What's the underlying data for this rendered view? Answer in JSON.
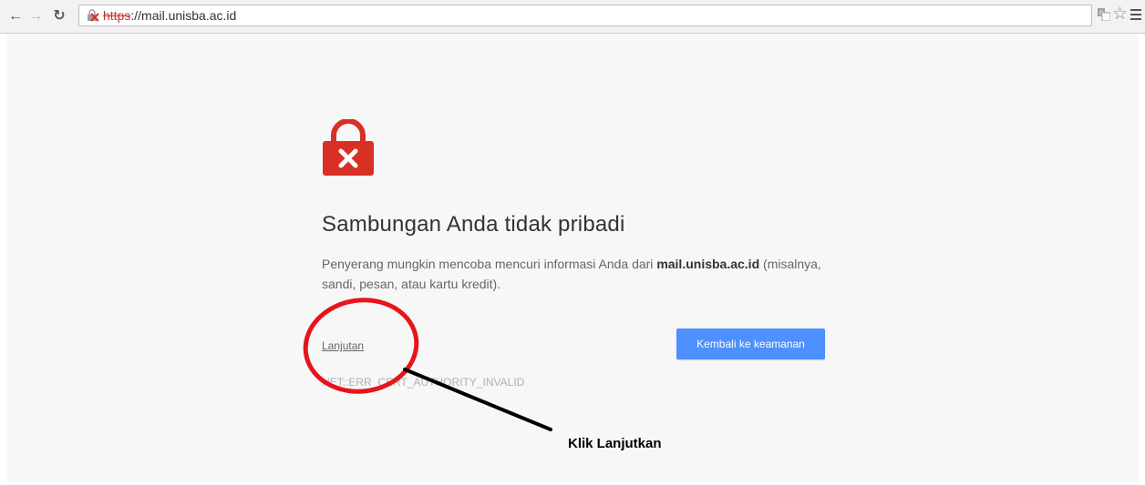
{
  "browser": {
    "url_scheme": "https",
    "url_rest": "://mail.unisba.ac.id"
  },
  "interstitial": {
    "heading": "Sambungan Anda tidak pribadi",
    "explanation_before": "Penyerang mungkin mencoba mencuri informasi Anda dari ",
    "explanation_domain": "mail.unisba.ac.id",
    "explanation_after": " (misalnya, sandi, pesan, atau kartu kredit).",
    "advanced_link": "Lanjutan",
    "back_button": "Kembali ke keamanan",
    "error_code": "NET::ERR_CERT_AUTHORITY_INVALID"
  },
  "annotation": {
    "label": "Klik Lanjutkan"
  },
  "icons": {
    "back": "back-arrow-icon",
    "forward": "forward-arrow-icon",
    "reload": "reload-icon",
    "broken_lock": "broken-lock-icon",
    "translate": "translate-icon",
    "bookmark": "star-icon",
    "menu": "hamburger-menu-icon",
    "big_lock": "red-lock-icon"
  },
  "colors": {
    "danger": "#d93025",
    "button": "#4d90fe",
    "annotation": "#e8141c"
  }
}
